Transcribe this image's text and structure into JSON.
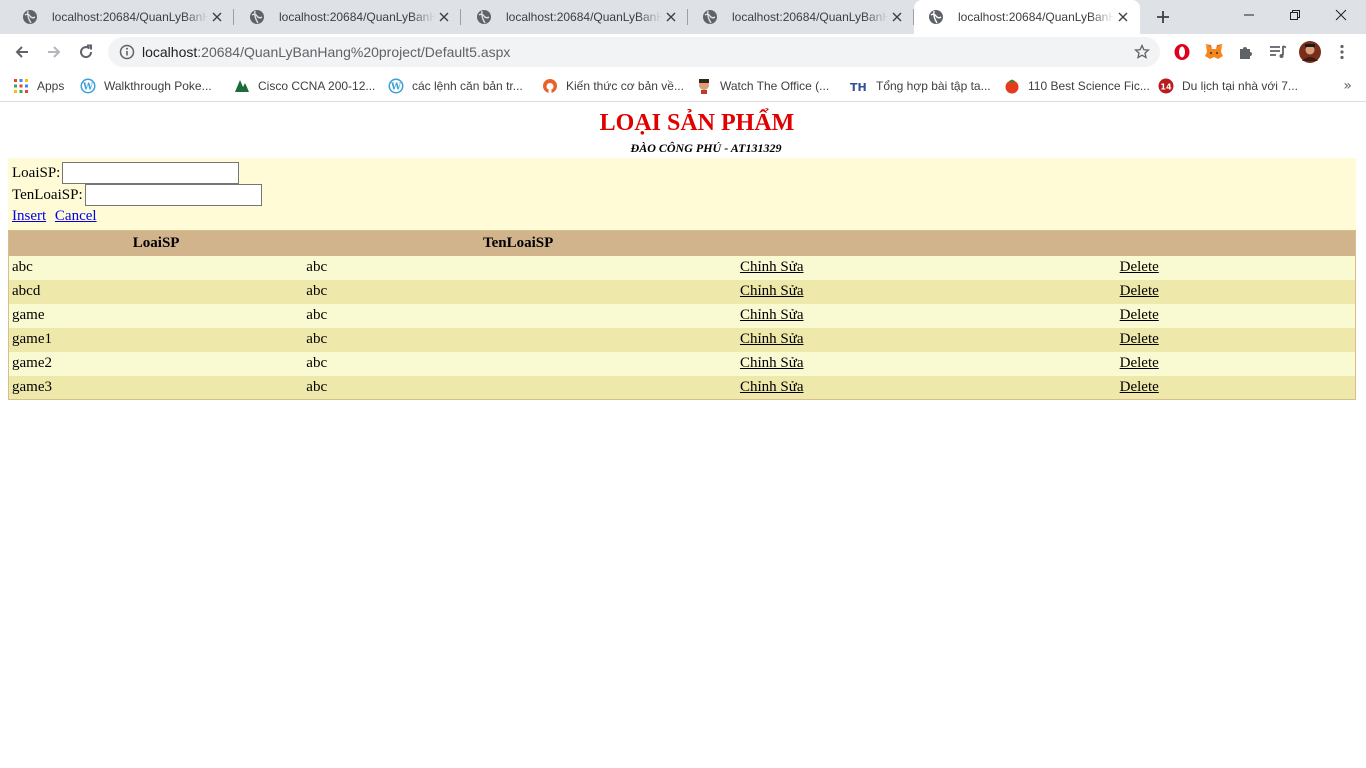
{
  "browser": {
    "tabs": [
      {
        "title": "localhost:20684/QuanLyBanHang%20project/Default5.aspx",
        "active": false
      },
      {
        "title": "localhost:20684/QuanLyBanHang%20project/Default5.aspx",
        "active": false
      },
      {
        "title": "localhost:20684/QuanLyBanHang%20project/Default5.aspx",
        "active": false
      },
      {
        "title": "localhost:20684/QuanLyBanHang%20project/Default5.aspx",
        "active": false
      },
      {
        "title": "localhost:20684/QuanLyBanHang%20project/Default5.aspx",
        "active": true
      }
    ],
    "url_host": "localhost",
    "url_rest": ":20684/QuanLyBanHang%20project/Default5.aspx",
    "bookmarks": [
      {
        "label": "Apps",
        "icon": "apps-grid-icon"
      },
      {
        "label": "Walkthrough Poke...",
        "icon": "wordpress-icon"
      },
      {
        "label": "Cisco CCNA 200-12...",
        "icon": "pa-logo-icon"
      },
      {
        "label": "các lệnh căn bản tr...",
        "icon": "wordpress-icon"
      },
      {
        "label": "Kiến thức cơ bản về...",
        "icon": "github-icon"
      },
      {
        "label": "Watch The Office (...",
        "icon": "face-icon"
      },
      {
        "label": "Tổng hợp bài tập ta...",
        "icon": "th-logo-icon"
      },
      {
        "label": "110 Best Science Fic...",
        "icon": "tomato-icon"
      },
      {
        "label": "Du lịch tại nhà với 7...",
        "icon": "calendar-14-icon"
      }
    ]
  },
  "page": {
    "title": "LOẠI SẢN PHẨM",
    "subtitle": "ĐÀO CÔNG PHÚ - AT131329",
    "form": {
      "loaisp_label": "LoaiSP:",
      "loaisp_value": "",
      "tenloaisp_label": "TenLoaiSP:",
      "tenloaisp_value": "",
      "insert_label": "Insert",
      "cancel_label": "Cancel"
    },
    "table": {
      "headers": [
        "LoaiSP",
        "TenLoaiSP",
        "",
        ""
      ],
      "edit_label": "Chỉnh Sửa",
      "delete_label": "Delete",
      "rows": [
        {
          "loaisp": "abc",
          "tenloaisp": "abc"
        },
        {
          "loaisp": "abcd",
          "tenloaisp": "abc"
        },
        {
          "loaisp": "game",
          "tenloaisp": "abc"
        },
        {
          "loaisp": "game1",
          "tenloaisp": "abc"
        },
        {
          "loaisp": "game2",
          "tenloaisp": "abc"
        },
        {
          "loaisp": "game3",
          "tenloaisp": "abc"
        }
      ]
    }
  },
  "colors": {
    "title_red": "#e00000",
    "form_bg": "#fffbd6",
    "header_bg": "#d2b48c",
    "row_odd": "#fafad2",
    "row_even": "#eee8aa"
  }
}
